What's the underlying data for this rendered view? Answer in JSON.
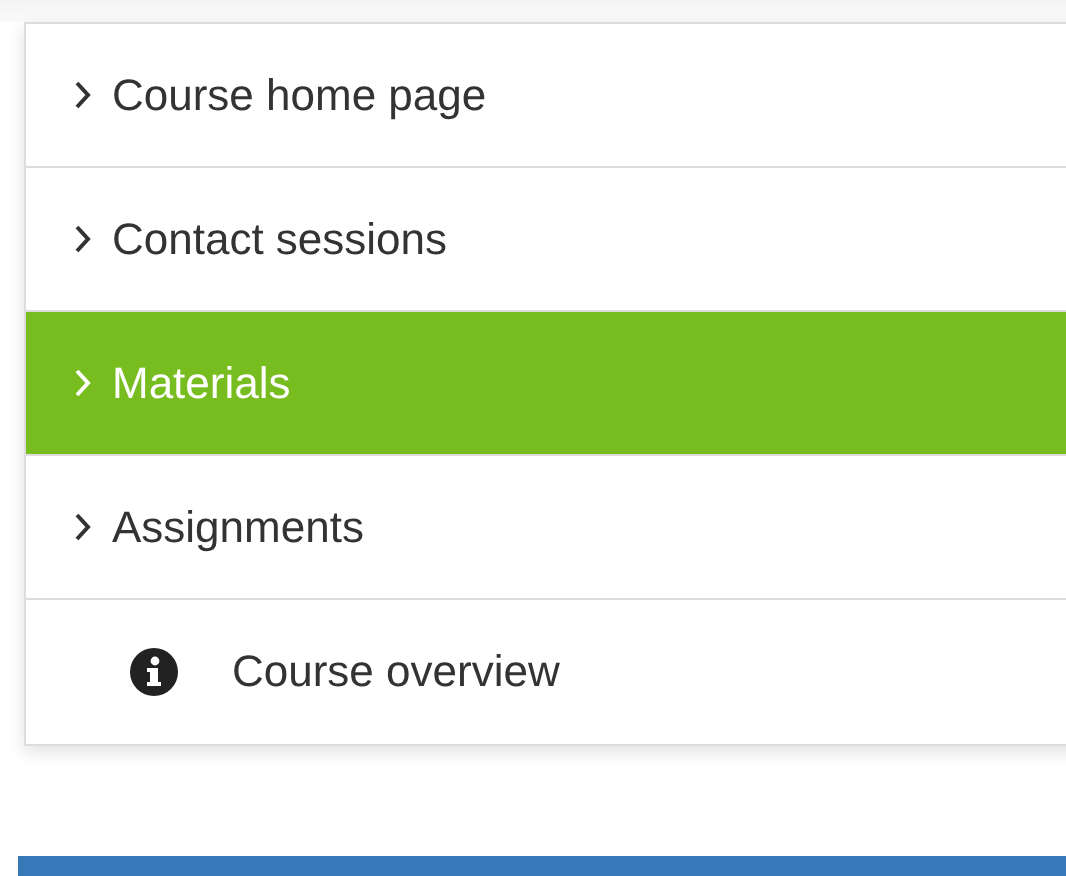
{
  "nav": {
    "items": [
      {
        "kind": "link",
        "label": "Course home page",
        "selected": false
      },
      {
        "kind": "link",
        "label": "Contact sessions",
        "selected": false
      },
      {
        "kind": "link",
        "label": "Materials",
        "selected": true
      },
      {
        "kind": "link",
        "label": "Assignments",
        "selected": false
      },
      {
        "kind": "info",
        "label": "Course overview",
        "selected": false
      }
    ]
  }
}
